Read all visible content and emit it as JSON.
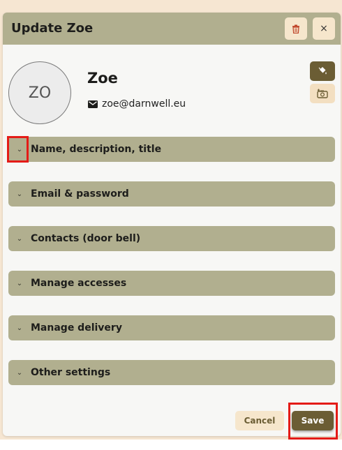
{
  "dialog": {
    "title": "Update Zoe",
    "close_label": "×",
    "delete_icon": "trash-icon"
  },
  "profile": {
    "initials": "ZO",
    "name": "Zoe",
    "email": "zoe@darnwell.eu",
    "email_icon": "envelope-icon",
    "paint_icon": "paint-bucket-icon",
    "photo_icon": "add-photo-icon"
  },
  "sections": [
    {
      "label": "Name, description, title"
    },
    {
      "label": "Email & password"
    },
    {
      "label": "Contacts (door bell)"
    },
    {
      "label": "Manage accesses"
    },
    {
      "label": "Manage delivery"
    },
    {
      "label": "Other settings"
    }
  ],
  "footer": {
    "cancel_label": "Cancel",
    "save_label": "Save"
  },
  "colors": {
    "header": "#b1af8f",
    "accent_dark": "#6b5d34",
    "accent_light": "#f6e6cc",
    "highlight": "#e41b17"
  }
}
